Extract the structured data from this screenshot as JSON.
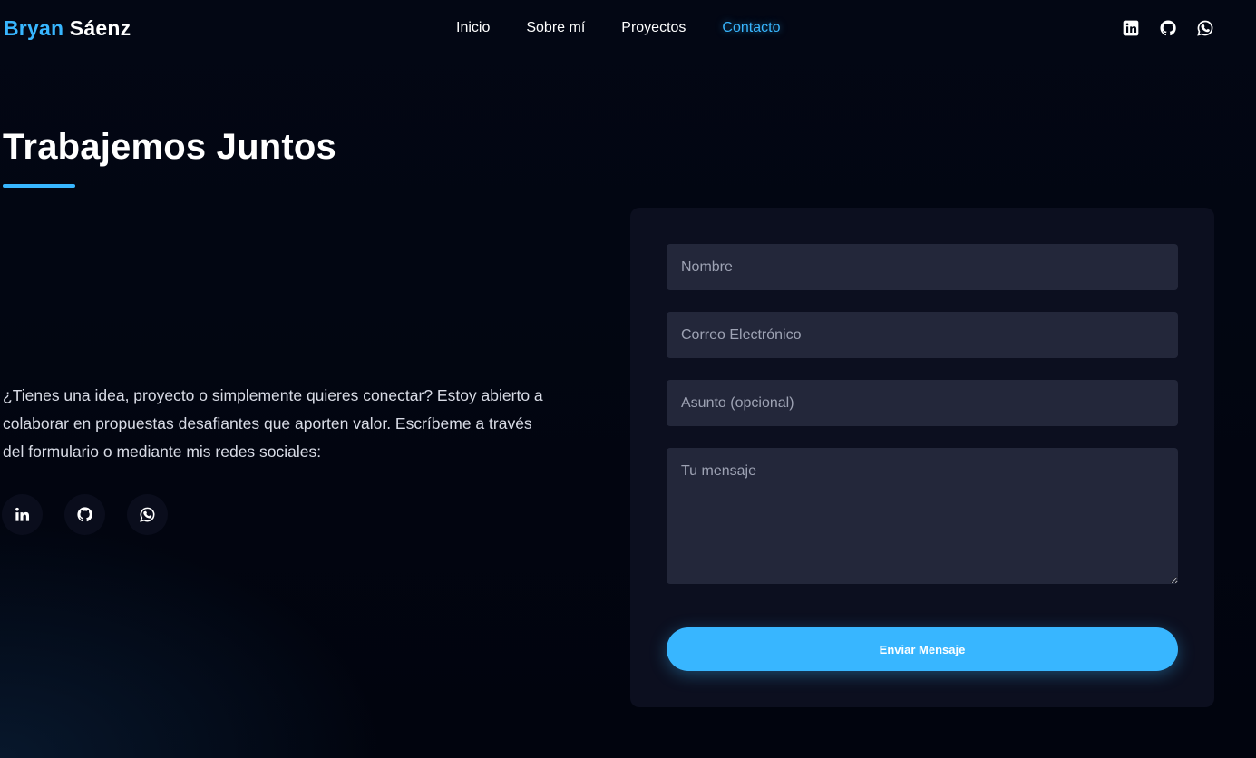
{
  "brand": {
    "first": "Bryan",
    "last": "Sáenz"
  },
  "nav": {
    "items": [
      {
        "label": "Inicio",
        "active": false
      },
      {
        "label": "Sobre mí",
        "active": false
      },
      {
        "label": "Proyectos",
        "active": false
      },
      {
        "label": "Contacto",
        "active": true
      }
    ]
  },
  "header_social": [
    "linkedin-icon",
    "github-icon",
    "whatsapp-icon"
  ],
  "contact": {
    "title": "Trabajemos Juntos",
    "description": "¿Tienes una idea, proyecto o simplemente quieres conectar? Estoy abierto a colaborar en propuestas desafiantes que aporten valor. Escríbeme a través del formulario o mediante mis redes sociales:",
    "social": [
      "linkedin-icon",
      "github-icon",
      "whatsapp-icon"
    ]
  },
  "form": {
    "name_placeholder": "Nombre",
    "email_placeholder": "Correo Electrónico",
    "subject_placeholder": "Asunto (opcional)",
    "message_placeholder": "Tu mensaje",
    "submit_label": "Enviar Mensaje"
  },
  "colors": {
    "accent": "#38b6ff",
    "background": "#020611",
    "card": "#0c0f1f",
    "field": "#23273a"
  }
}
